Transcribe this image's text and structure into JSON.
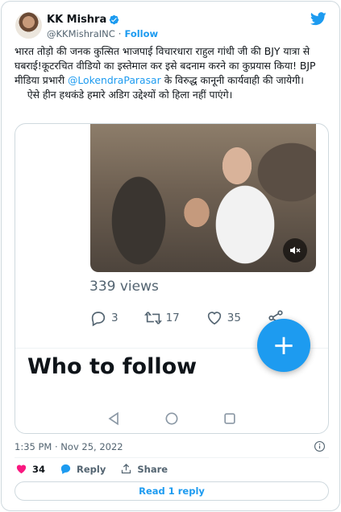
{
  "author": {
    "name": "KK Mishra",
    "handle": "@KKMishraINC",
    "separator": "·",
    "follow_label": "Follow"
  },
  "tweet": {
    "text_part1": "भारत तोड़ो की जनक कुत्सित भाजपाई विचारधारा राहुल गांधी जी की BJY यात्रा से घबराई!कूटरचित वीडियो का इस्तेमाल कर इसे बदनाम करने का कुप्रयास किया! BJP मीडिया प्रभारी ",
    "mention": "@LokendraParasar",
    "text_part2": " के विरुद्ध कानूनी कार्यवाही की जायेगी।\n    ऐसे हीन हथकंडे हमारे अडिग उद्देश्यों को हिला नहीं पाएंगे।"
  },
  "media": {
    "views": "339 views",
    "replies": "3",
    "retweets": "17",
    "likes": "35",
    "section_title": "Who to follow",
    "fab_symbol": "+"
  },
  "timestamp": "1:35 PM · Nov 25, 2022",
  "footer": {
    "like_count": "34",
    "reply_label": "Reply",
    "share_label": "Share",
    "read_reply_label": "Read 1 reply"
  },
  "colors": {
    "accent": "#1d9bf0",
    "like": "#f91880",
    "text": "#0f1419",
    "secondary": "#536471"
  }
}
